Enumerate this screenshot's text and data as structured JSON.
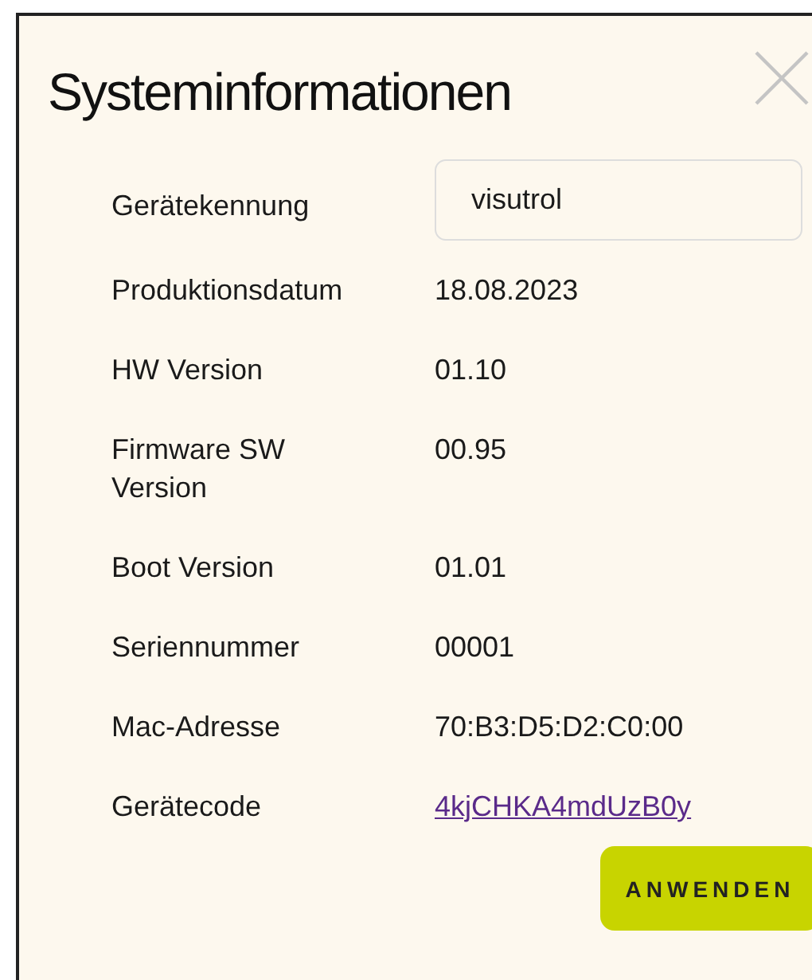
{
  "dialog": {
    "title": "Systeminformationen",
    "rows": [
      {
        "label": "Gerätekennung",
        "kind": "field",
        "value": "visutrol"
      },
      {
        "label": "Produktionsdatum",
        "kind": "text",
        "value": "18.08.2023"
      },
      {
        "label": "HW Version",
        "kind": "text",
        "value": "01.10"
      },
      {
        "label": "Firmware SW Version",
        "kind": "text",
        "value": "00.95"
      },
      {
        "label": "Boot Version",
        "kind": "text",
        "value": "01.01"
      },
      {
        "label": "Seriennummer",
        "kind": "text",
        "value": "00001"
      },
      {
        "label": "Mac-Adresse",
        "kind": "text",
        "value": "70:B3:D5:D2:C0:00"
      },
      {
        "label": "Gerätecode",
        "kind": "link",
        "value": "4kjCHKA4mdUzB0y"
      }
    ],
    "button": "ANWENDEN"
  }
}
